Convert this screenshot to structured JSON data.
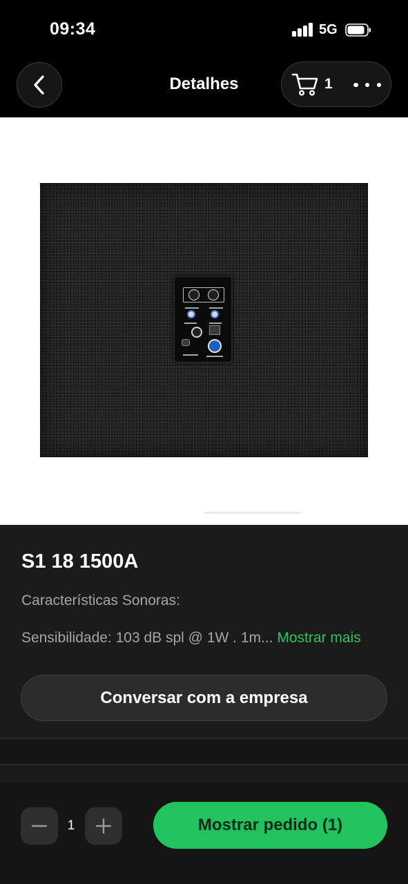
{
  "status_bar": {
    "time": "09:34",
    "network": "5G",
    "icons": [
      "signal-icon",
      "battery-icon"
    ]
  },
  "nav": {
    "back_icon": "chevron-left-icon",
    "title": "Detalhes",
    "cart_icon": "cart-icon",
    "cart_count": "1",
    "more_icon": "more-dots-icon"
  },
  "product": {
    "title": "S1 18 1500A",
    "feature_heading": "Características Sonoras:",
    "description": "Sensibilidade: 103 dB spl @ 1W . 1m...",
    "show_more": "Mostrar mais",
    "chat_button": "Conversar com a empresa"
  },
  "order_bar": {
    "quantity": "1",
    "minus_icon": "minus-icon",
    "plus_icon": "plus-icon",
    "order_button": "Mostrar pedido (1)"
  },
  "colors": {
    "accent_green": "#22c35e",
    "link_green": "#2fc35f",
    "background": "#1b1b1b"
  }
}
